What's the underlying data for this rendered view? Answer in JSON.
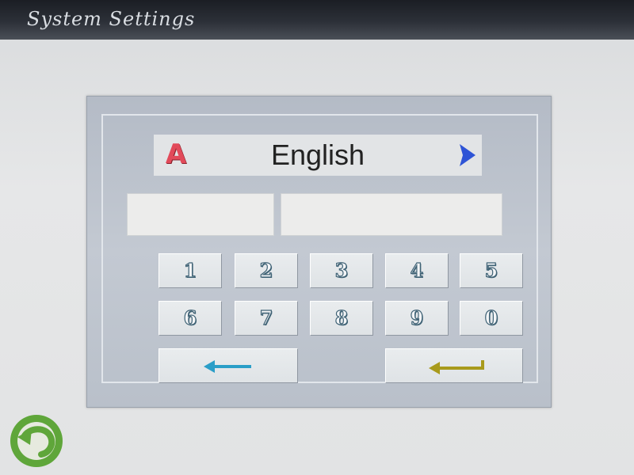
{
  "header": {
    "title": "System Settings"
  },
  "language": {
    "icon": "A",
    "icon_name": "alphabet-a-icon",
    "label": "English",
    "next_icon": "chevron-right-icon"
  },
  "fields": {
    "left_value": "",
    "right_value": ""
  },
  "keypad": {
    "keys": [
      "1",
      "2",
      "3",
      "4",
      "5",
      "6",
      "7",
      "8",
      "9",
      "0"
    ],
    "backspace_icon": "arrow-left-icon",
    "enter_icon": "enter-return-icon"
  },
  "footer": {
    "back_icon": "back-arrow-icon"
  },
  "colors": {
    "topbar": "#2c3038",
    "panel": "#bfc6cf",
    "key_digit_outline": "#3f6275",
    "backspace_arrow": "#2a9ec8",
    "enter_arrow": "#a89a1c",
    "chevron": "#2e54d6",
    "lang_icon": "#e24a5a",
    "back_button": "#5fa63a"
  }
}
